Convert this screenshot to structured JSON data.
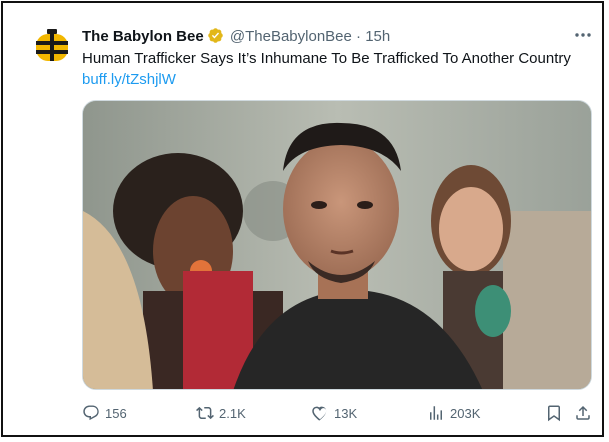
{
  "tweet": {
    "author_name": "The Babylon Bee",
    "handle": "@TheBabylonBee",
    "separator": "·",
    "time": "15h",
    "text": "Human Trafficker Says It’s Inhumane To Be Trafficked To Another Country",
    "link": "buff.ly/tZshjlW",
    "media": {
      "icon": "photo"
    }
  },
  "actions": {
    "replies": "156",
    "reposts": "2.1K",
    "likes": "13K",
    "views": "203K"
  },
  "colors": {
    "accent": "#1d9bf0",
    "verified": "#e2b719",
    "secondary_text": "#536471",
    "logo_yellow": "#f2b700"
  }
}
